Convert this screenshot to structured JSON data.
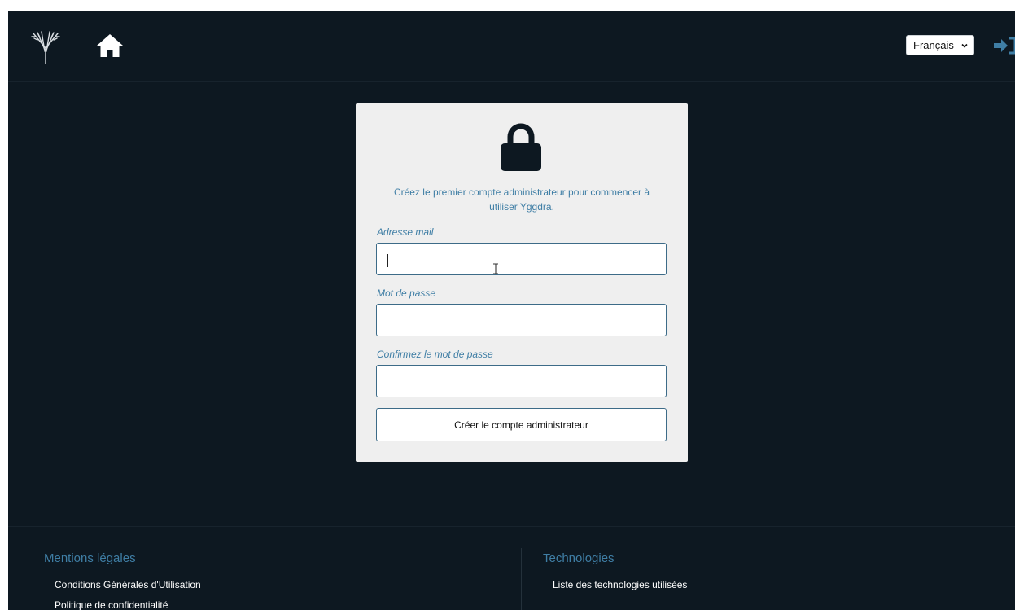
{
  "header": {
    "language": "Français"
  },
  "card": {
    "intro": "Créez le premier compte administrateur pour commencer à utiliser Yggdra.",
    "email_label": "Adresse mail",
    "email_value": "",
    "password_label": "Mot de passe",
    "password_value": "",
    "confirm_label": "Confirmez le mot de passe",
    "confirm_value": "",
    "submit_label": "Créer le compte administrateur"
  },
  "footer": {
    "legal_title": "Mentions légales",
    "legal_links": [
      "Conditions Générales d'Utilisation",
      "Politique de confidentialité"
    ],
    "tech_title": "Technologies",
    "tech_links": [
      "Liste des technologies utilisées"
    ]
  },
  "icons": {
    "logo": "tree-logo",
    "home": "home-icon",
    "login": "sign-in-icon",
    "lock": "lock-icon"
  },
  "colors": {
    "background": "#0d1821",
    "card": "#efefef",
    "accent": "#3f7ea5",
    "input_border": "#3d6b88"
  }
}
